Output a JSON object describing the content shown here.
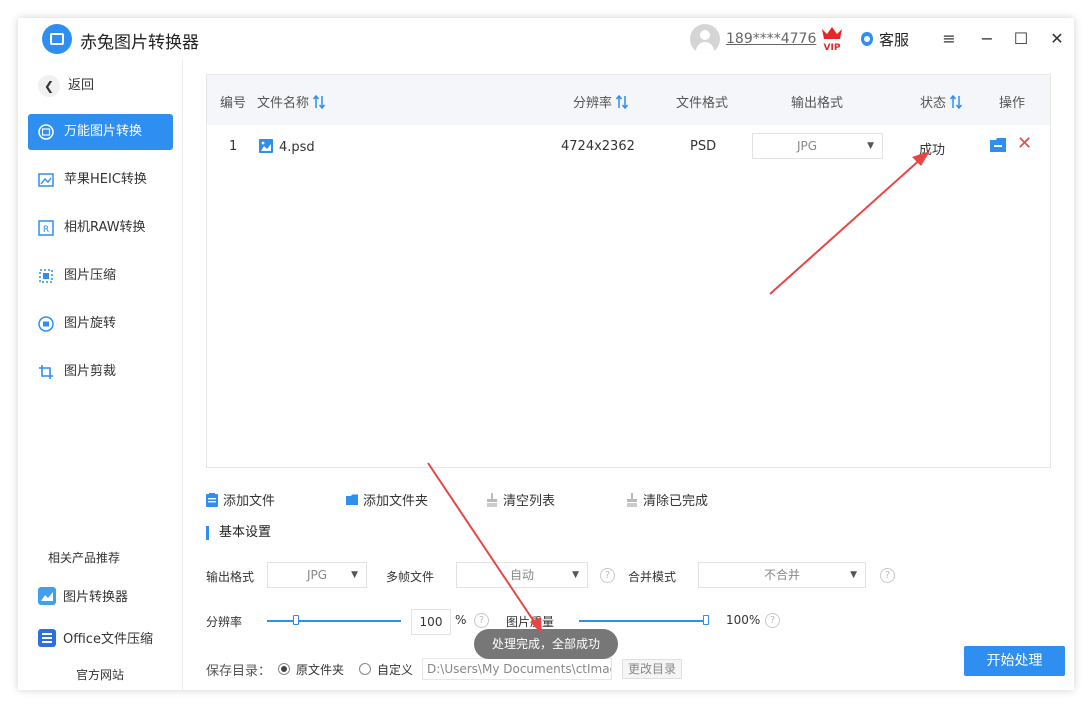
{
  "app": {
    "title": "赤兔图片转换器"
  },
  "header": {
    "phone": "189****4776",
    "vip_label": "VIP",
    "service_label": "客服"
  },
  "window_controls": {
    "menu": "≡",
    "minimize": "−",
    "maximize": "☐",
    "close": "✕"
  },
  "sidebar": {
    "back_label": "返回",
    "items": [
      {
        "label": "万能图片转换",
        "icon": "image-convert-icon",
        "active": true
      },
      {
        "label": "苹果HEIC转换",
        "icon": "heic-icon",
        "active": false
      },
      {
        "label": "相机RAW转换",
        "icon": "raw-icon",
        "active": false
      },
      {
        "label": "图片压缩",
        "icon": "compress-icon",
        "active": false
      },
      {
        "label": "图片旋转",
        "icon": "rotate-icon",
        "active": false
      },
      {
        "label": "图片剪裁",
        "icon": "crop-icon",
        "active": false
      }
    ],
    "recommend_title": "相关产品推荐",
    "recommend": [
      {
        "label": "图片转换器",
        "icon": "image-app-icon"
      },
      {
        "label": "Office文件压缩",
        "icon": "office-app-icon"
      }
    ],
    "official_site": "官方网站"
  },
  "table": {
    "headers": {
      "id": "编号",
      "name": "文件名称",
      "resolution": "分辨率",
      "file_format": "文件格式",
      "output_format": "输出格式",
      "status": "状态",
      "action": "操作"
    },
    "rows": [
      {
        "id": "1",
        "name": "4.psd",
        "resolution": "4724x2362",
        "file_format": "PSD",
        "output_format": "JPG",
        "status": "成功"
      }
    ]
  },
  "toolbar": {
    "add_file": "添加文件",
    "add_folder": "添加文件夹",
    "clear_list": "清空列表",
    "clear_done": "清除已完成"
  },
  "settings": {
    "title": "基本设置",
    "output_format_label": "输出格式",
    "output_format_value": "JPG",
    "multiframe_label": "多帧文件",
    "multiframe_value": "自动",
    "merge_label": "合并模式",
    "merge_value": "不合并",
    "resolution_label": "分辨率",
    "resolution_value": "100",
    "resolution_unit": "%",
    "quality_label": "图片质量",
    "quality_value": "100%",
    "help_glyph": "?"
  },
  "save": {
    "label": "保存目录：",
    "option_original": "原文件夹",
    "option_custom": "自定义",
    "path": "D:\\Users\\My Documents\\ctImageC",
    "change_label": "更改目录"
  },
  "start_button": "开始处理",
  "toast": "处理完成，全部成功",
  "colors": {
    "accent": "#2e8ff0",
    "danger": "#e84b4b",
    "annotation_arrow": "#e84545"
  }
}
